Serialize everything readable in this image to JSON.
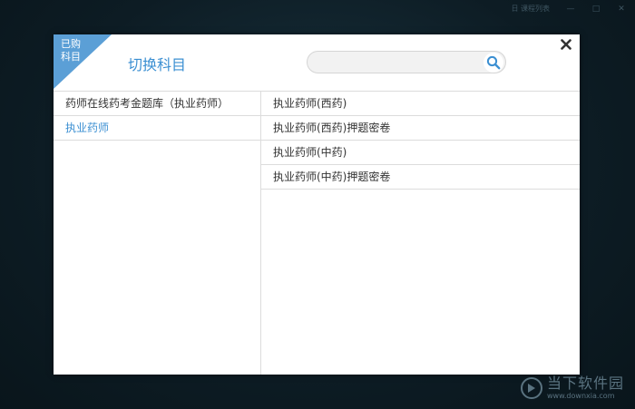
{
  "window": {
    "top_right_text": "日 课程列表",
    "minimize": "—",
    "maximize": "□",
    "close": "✕"
  },
  "dialog": {
    "badge_line1": "已购",
    "badge_line2": "科目",
    "title": "切换科目",
    "search_value": "",
    "search_placeholder": "",
    "close_glyph": "✖"
  },
  "left_list": [
    {
      "label": "药师在线药考金题库（执业药师）",
      "active": false
    },
    {
      "label": "执业药师",
      "active": true
    }
  ],
  "right_list": [
    {
      "label": "执业药师(西药)"
    },
    {
      "label": "执业药师(西药)押题密卷"
    },
    {
      "label": "执业药师(中药)"
    },
    {
      "label": "执业药师(中药)押题密卷"
    }
  ],
  "watermark": {
    "name": "当下软件园",
    "url": "www.downxia.com"
  },
  "colors": {
    "accent": "#3b8fd2",
    "badge": "#5b9fd6",
    "background": "#0f1f27"
  }
}
